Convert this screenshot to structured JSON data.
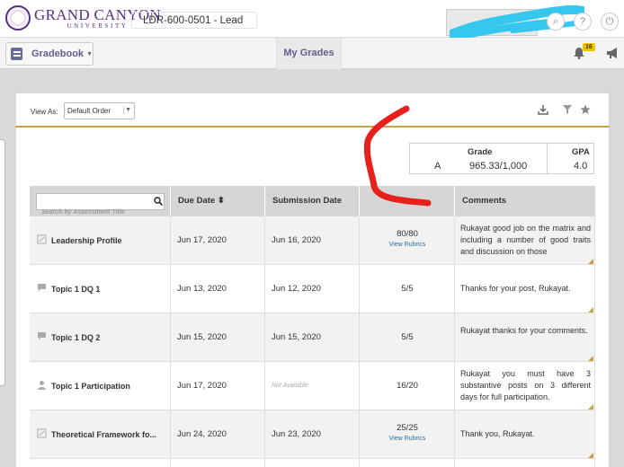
{
  "header": {
    "logo_main": "GRAND CANYON",
    "logo_sub": "UNIVERSITY",
    "course": "LDR-600-0501 - Lead",
    "search_glyph": "⌕",
    "help_glyph": "?",
    "power_glyph": "⏻"
  },
  "subbar": {
    "gradebook_label": "Gradebook",
    "my_grades_tab": "My Grades",
    "notification_count": "16"
  },
  "toolbar": {
    "view_as_label": "View As:",
    "view_as_value": "Default Order"
  },
  "summary": {
    "grade_label": "Grade",
    "letter_grade": "A",
    "points": "965.33/1,000",
    "gpa_label": "GPA",
    "gpa_value": "4.0"
  },
  "table": {
    "search_placeholder": "Search by Assessment Title",
    "columns": [
      "Due Date ⬍",
      "Submission Date",
      "",
      "Comments"
    ],
    "rows": [
      {
        "icon": "assignment-icon",
        "title": "Leadership Profile",
        "due": "Jun 17, 2020",
        "submitted": "Jun 16, 2020",
        "score": "80/80",
        "rubric": "View Rubrics",
        "comment": "Rukayat good job on the matrix and including a number of good traits and discussion on those"
      },
      {
        "icon": "discussion-icon",
        "title": "Topic 1 DQ 1",
        "due": "Jun 13, 2020",
        "submitted": "Jun 12, 2020",
        "score": "5/5",
        "rubric": "",
        "comment": "Thanks for your post, Rukayat."
      },
      {
        "icon": "discussion-icon",
        "title": "Topic 1 DQ 2",
        "due": "Jun 15, 2020",
        "submitted": "Jun 15, 2020",
        "score": "5/5",
        "rubric": "",
        "comment": "Rukayat thanks for your comments."
      },
      {
        "icon": "participation-icon",
        "title": "Topic 1 Participation",
        "due": "Jun 17, 2020",
        "submitted": "Not Available",
        "score": "16/20",
        "rubric": "",
        "comment": "Rukayat you must have 3 substantive posts on 3 different days for full participation."
      },
      {
        "icon": "assignment-icon",
        "title": "Theoretical Framework fo...",
        "due": "Jun 24, 2020",
        "submitted": "Jun 23, 2020",
        "score": "25/25",
        "rubric": "View Rubrics",
        "comment": "Thank you, Rukayat."
      }
    ]
  },
  "colors": {
    "brand_purple": "#5a2d82",
    "accent_gold": "#c8a24a",
    "annotation_red": "#e8201c",
    "scribble_cyan": "#35c8ef"
  }
}
